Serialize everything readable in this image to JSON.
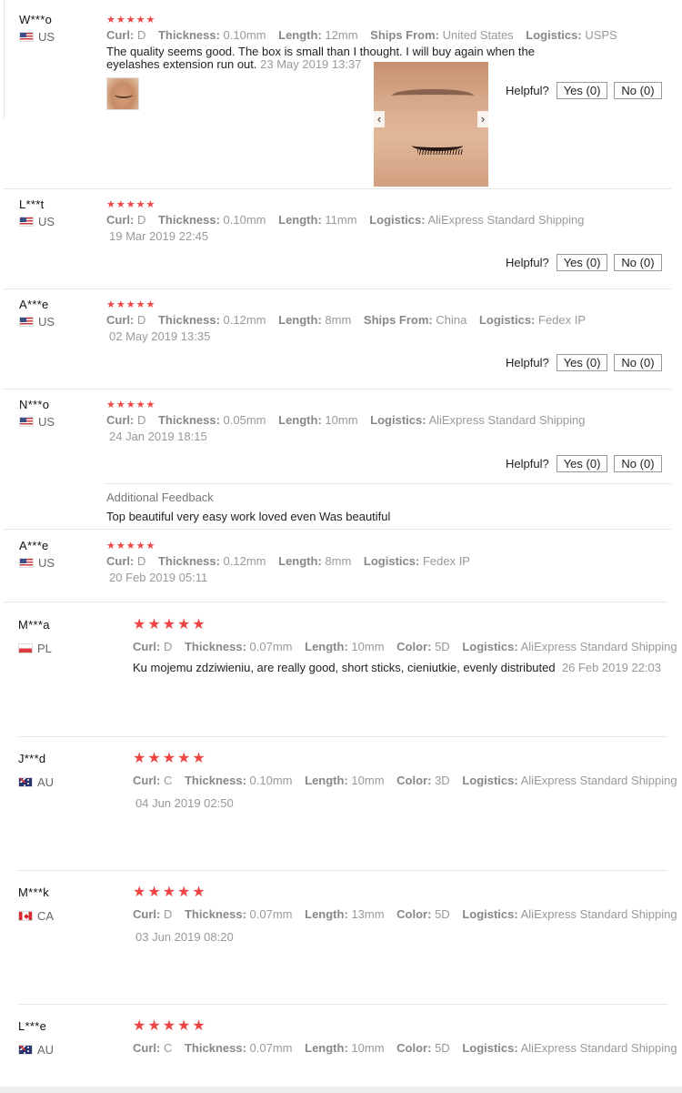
{
  "labels": {
    "curl": "Curl:",
    "thickness": "Thickness:",
    "length": "Length:",
    "ships_from": "Ships From:",
    "logistics": "Logistics:",
    "color": "Color:",
    "helpful": "Helpful?",
    "yes": "Yes (0)",
    "no": "No (0)",
    "additional_feedback": "Additional Feedback"
  },
  "stars": "★★★★★",
  "reviews": [
    {
      "user": "W***o",
      "country": "US",
      "curl": "D",
      "thickness": "0.10mm",
      "length": "12mm",
      "ships_from": "United States",
      "logistics": "USPS",
      "text_line1": "The quality seems good. The box is small than I thought. I will buy again when the",
      "text_line2": "eyelashes extension run out.",
      "date": "23 May 2019 13:37"
    },
    {
      "user": "L***t",
      "country": "US",
      "curl": "D",
      "thickness": "0.10mm",
      "length": "11mm",
      "logistics": "AliExpress Standard Shipping",
      "date": "19 Mar 2019 22:45"
    },
    {
      "user": "A***e",
      "country": "US",
      "curl": "D",
      "thickness": "0.12mm",
      "length": "8mm",
      "ships_from": "China",
      "logistics": "Fedex IP",
      "date": "02 May 2019 13:35"
    },
    {
      "user": "N***o",
      "country": "US",
      "curl": "D",
      "thickness": "0.05mm",
      "length": "10mm",
      "logistics": "AliExpress Standard Shipping",
      "date": "24 Jan 2019 18:15",
      "additional_feedback": "Top beautiful very easy work loved even Was beautiful"
    },
    {
      "user": "A***e",
      "country": "US",
      "curl": "D",
      "thickness": "0.12mm",
      "length": "8mm",
      "logistics": "Fedex IP",
      "date": "20 Feb 2019 05:11"
    },
    {
      "user": "M***a",
      "country": "PL",
      "curl": "D",
      "thickness": "0.07mm",
      "length": "10mm",
      "color": "5D",
      "logistics": "AliExpress Standard Shipping",
      "text": "Ku mojemu zdziwieniu, are really good, short sticks, cieniutkie, evenly distributed",
      "date": "26 Feb 2019 22:03"
    },
    {
      "user": "J***d",
      "country": "AU",
      "curl": "C",
      "thickness": "0.10mm",
      "length": "10mm",
      "color": "3D",
      "logistics": "AliExpress Standard Shipping",
      "date": "04 Jun 2019 02:50"
    },
    {
      "user": "M***k",
      "country": "CA",
      "curl": "D",
      "thickness": "0.07mm",
      "length": "13mm",
      "color": "5D",
      "logistics": "AliExpress Standard Shipping",
      "date": "03 Jun 2019 08:20"
    },
    {
      "user": "L***e",
      "country": "AU",
      "curl": "C",
      "thickness": "0.07mm",
      "length": "10mm",
      "color": "5D",
      "logistics": "AliExpress Standard Shipping"
    }
  ],
  "colors": {
    "star": "#ee4444",
    "muted": "#999999",
    "divider": "#e6e6e6"
  }
}
